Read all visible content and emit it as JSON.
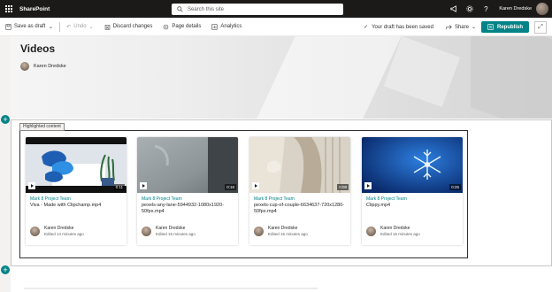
{
  "suite": {
    "app_name": "SharePoint",
    "search_placeholder": "Search this site",
    "user_name": "Karen Dredske",
    "icons": [
      "megaphone-icon",
      "gear-icon",
      "help-icon"
    ]
  },
  "commands": {
    "save_as_draft": "Save as draft",
    "undo": "Undo",
    "discard": "Discard changes",
    "page_details": "Page details",
    "analytics": "Analytics",
    "saved_status": "Your draft has been saved",
    "share": "Share",
    "republish": "Republish"
  },
  "page": {
    "title": "Videos",
    "author": "Karen Dredske"
  },
  "webpart": {
    "label": "Highlighted content",
    "cards": [
      {
        "site": "Mark 8 Project Team",
        "title": "Viva - Made with Clipchamp.mp4",
        "duration": "0:11",
        "author": "Karen Dredske",
        "edited": "Edited 14 minutes ago"
      },
      {
        "site": "Mark 8 Project Team",
        "title": "pexels-any-lane-5944932-1080x1920-50fps.mp4",
        "duration": "0:16",
        "author": "Karen Dredske",
        "edited": "Edited 15 minutes ago"
      },
      {
        "site": "Mark 8 Project Team",
        "title": "pexels-cup-of-couple-6634637-720x1280-50fps.mp4",
        "duration": "0:08",
        "author": "Karen Dredske",
        "edited": "Edited 15 minutes ago"
      },
      {
        "site": "Mark 8 Project Team",
        "title": "Clippy.mp4",
        "duration": "0:25",
        "author": "Karen Dredske",
        "edited": "Edited 16 minutes ago"
      }
    ]
  },
  "colors": {
    "suite_bar": "#1b1a19",
    "accent": "#038387",
    "site_link": "#038387"
  }
}
